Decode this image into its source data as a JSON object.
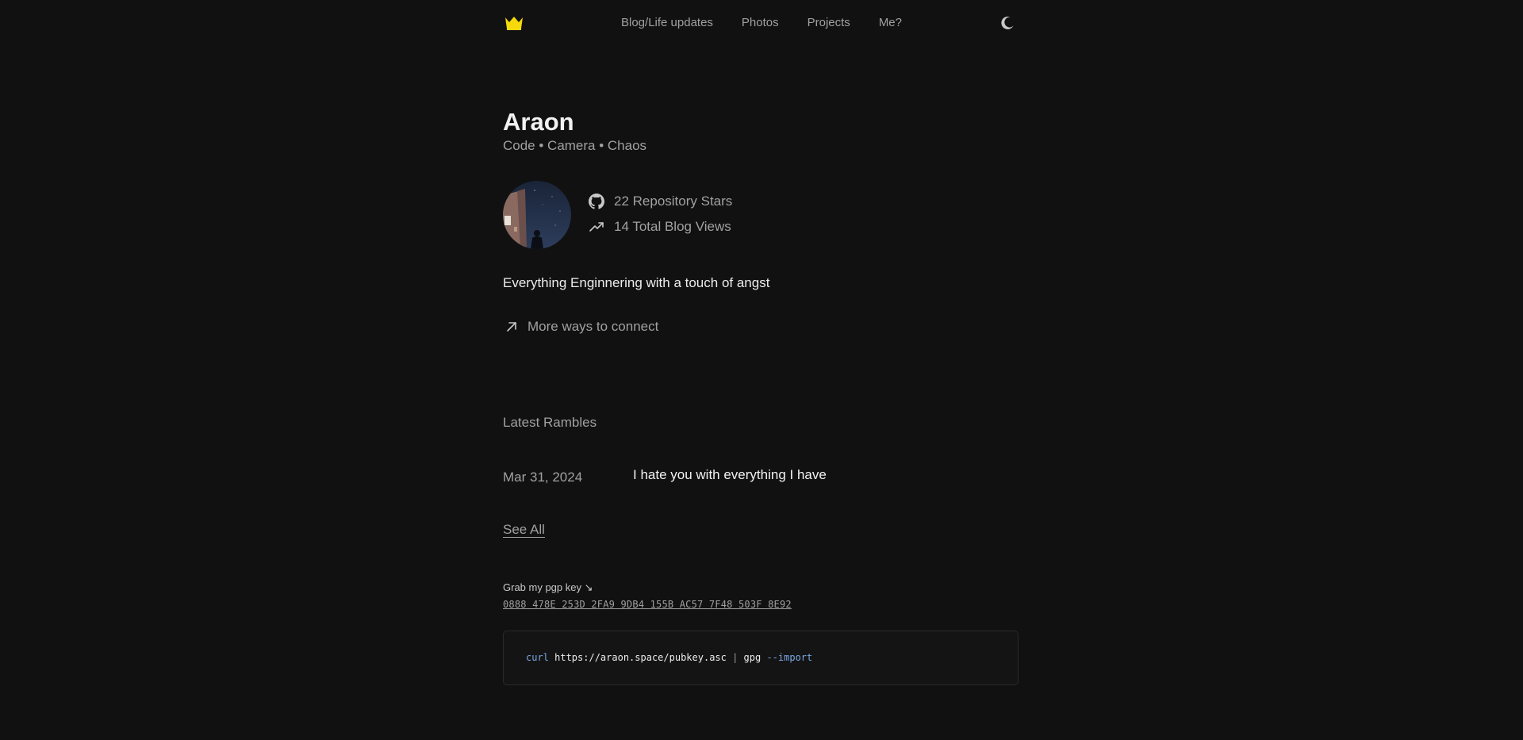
{
  "nav": {
    "logo": "crown-icon",
    "links": [
      "Blog/Life updates",
      "Photos",
      "Projects",
      "Me?"
    ],
    "theme_toggle": "moon-icon"
  },
  "profile": {
    "name": "Araon",
    "tagline": "Code • Camera • Chaos",
    "stats": [
      {
        "icon": "github-icon",
        "text": "22 Repository Stars"
      },
      {
        "icon": "trending-up-icon",
        "text": "14 Total Blog Views"
      }
    ],
    "description": "Everything Enginnering with a touch of angst",
    "connect_label": "More ways to connect"
  },
  "posts": {
    "title": "Latest Rambles",
    "items": [
      {
        "date": "Mar 31, 2024",
        "title": "I hate you with everything I have"
      }
    ],
    "see_all": "See All"
  },
  "pgp": {
    "label": "Grab my pgp key ↘",
    "fingerprint": "0888 478E 253D 2FA9 9DB4 155B AC57 7F48 503F 8E92",
    "code": {
      "cmd": "curl",
      "url": " https://araon.space/pubkey.asc ",
      "pipe": "|",
      "gpg": " gpg ",
      "flag": "--import"
    }
  },
  "colors": {
    "background": "#111111",
    "text": "#ededed",
    "muted": "#a1a1a1",
    "accent_logo": "#f5d90a",
    "code_keyword": "#7aa7e0"
  }
}
